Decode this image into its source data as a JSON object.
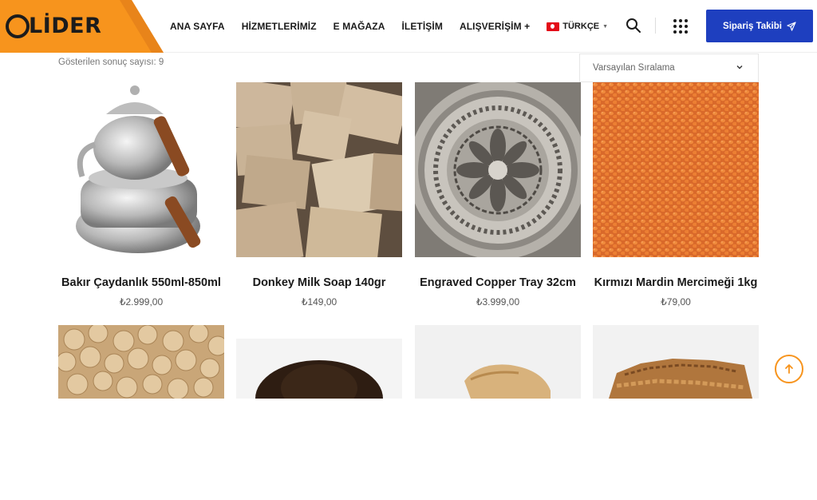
{
  "brand": {
    "name": "LİDER",
    "accent": "#f7941d"
  },
  "nav": {
    "items": [
      "ANA SAYFA",
      "HİZMETLERİMİZ",
      "E MAĞAZA",
      "İLETİŞİM",
      "ALIŞVERİŞİM +"
    ],
    "language": "TÜRKÇE"
  },
  "header": {
    "track_button": "Sipariş Takibi"
  },
  "toolbar": {
    "result_count": "Gösterilen sonuç sayısı: 9",
    "sort_selected": "Varsayılan Sıralama"
  },
  "products": [
    {
      "name": "Bakır Çaydanlık 550ml-850ml",
      "price": "₺2.999,00"
    },
    {
      "name": "Donkey Milk Soap 140gr",
      "price": "₺149,00"
    },
    {
      "name": "Engraved Copper Tray 32cm",
      "price": "₺3.999,00"
    },
    {
      "name": "Kırmızı Mardin Mercimeği 1kg",
      "price": "₺79,00"
    }
  ],
  "colors": {
    "primary_button": "#1e3fbf",
    "orange": "#f7941d"
  }
}
